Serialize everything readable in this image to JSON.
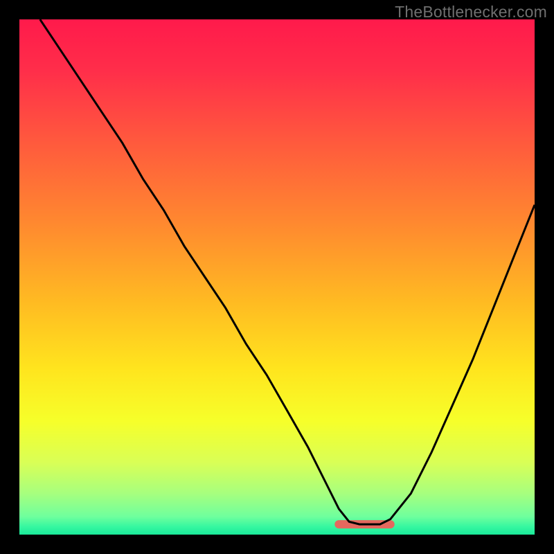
{
  "watermark": "TheBottlenecker.com",
  "colors": {
    "frame": "#000000",
    "curve": "#000000",
    "flat_segment": "#e4685e",
    "gradient_stops": [
      {
        "offset": 0.0,
        "color": "#ff1a4b"
      },
      {
        "offset": 0.1,
        "color": "#ff2e4a"
      },
      {
        "offset": 0.24,
        "color": "#ff5a3d"
      },
      {
        "offset": 0.4,
        "color": "#ff8a2f"
      },
      {
        "offset": 0.55,
        "color": "#ffbb22"
      },
      {
        "offset": 0.68,
        "color": "#ffe51e"
      },
      {
        "offset": 0.78,
        "color": "#f6ff2a"
      },
      {
        "offset": 0.86,
        "color": "#d9ff56"
      },
      {
        "offset": 0.92,
        "color": "#a7ff7e"
      },
      {
        "offset": 0.965,
        "color": "#6fff9d"
      },
      {
        "offset": 0.985,
        "color": "#35f7a0"
      },
      {
        "offset": 1.0,
        "color": "#1ae99a"
      }
    ]
  },
  "chart_data": {
    "type": "line",
    "title": "",
    "xlabel": "",
    "ylabel": "",
    "xlim": [
      0,
      100
    ],
    "ylim": [
      0,
      100
    ],
    "grid": false,
    "x": [
      4,
      8,
      12,
      16,
      20,
      24,
      28,
      32,
      36,
      40,
      44,
      48,
      52,
      56,
      60,
      62,
      64,
      66,
      68,
      70,
      72,
      76,
      80,
      84,
      88,
      92,
      96,
      100
    ],
    "values": [
      100,
      94,
      88,
      82,
      76,
      69,
      63,
      56,
      50,
      44,
      37,
      31,
      24,
      17,
      9,
      5,
      2.5,
      2,
      2,
      2,
      3,
      8,
      16,
      25,
      34,
      44,
      54,
      64
    ],
    "flat_segment": {
      "x_start": 62,
      "x_end": 72,
      "y": 2
    },
    "note": "Values are percentages read off the image; y is plotted inverted (0 at bottom). Flat segment is the thick colored plateau near the valley."
  }
}
